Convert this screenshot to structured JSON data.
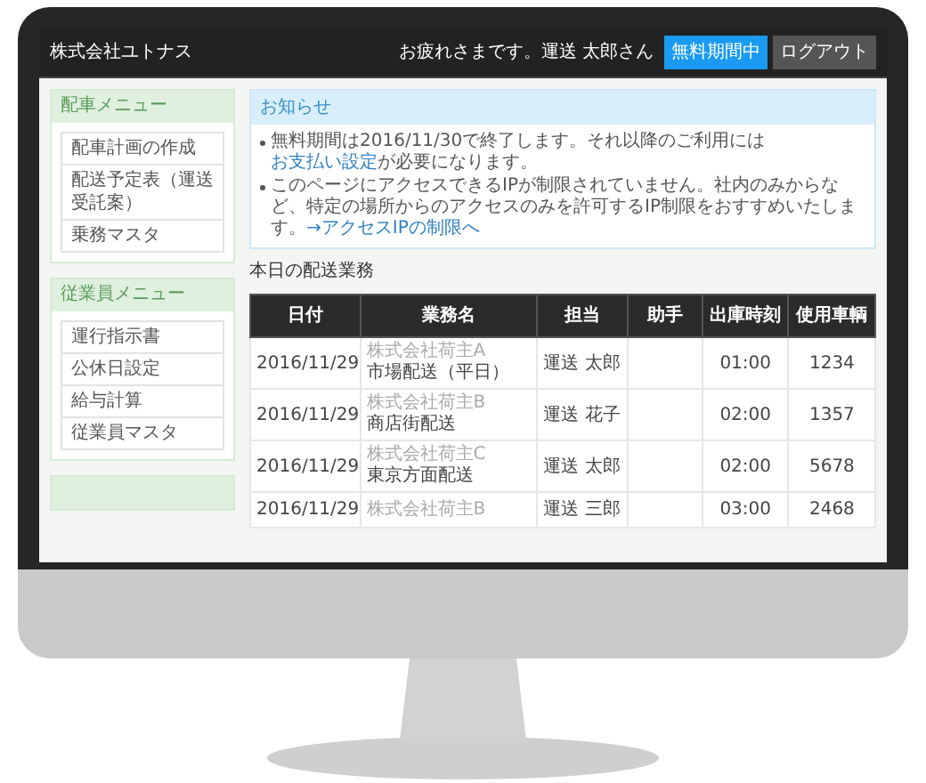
{
  "header": {
    "brand": "株式会社ユトナス",
    "greeting": "お疲れさまです。運送 太郎さん",
    "buttons": [
      {
        "kind": "primary",
        "label": "無料期間中"
      },
      {
        "kind": "secondary",
        "label": "ログアウト"
      }
    ]
  },
  "sidebar": [
    {
      "title": "配車メニュー",
      "items": [
        "配車計画の作成",
        "配送予定表（運送受託案）",
        "乗務マスタ"
      ]
    },
    {
      "title": "従業員メニュー",
      "items": [
        "運行指示書",
        "公休日設定",
        "給与計算",
        "従業員マスタ"
      ]
    }
  ],
  "notice": {
    "title": "お知らせ",
    "items": [
      "無料期間は2016/11/30で終了します。それ以降のご利用には**お支払い設定**が必要になります。",
      "このページにアクセスできるIPが制限されていません。社内のみからなど、特定の場所からのアクセスのみを許可するIP制限をおすすめいたします。**→アクセスIPの制限へ**"
    ]
  },
  "table": {
    "title": "本日の配送業務",
    "columns": [
      "日付",
      "業務名",
      "担当",
      "助手",
      "出庫時刻",
      "使用車輌"
    ],
    "rows": [
      {
        "date": "2016/11/29",
        "client": "株式会社荷主A",
        "task": "市場配送（平日）",
        "driver": "運送 太郎",
        "time": "01:00",
        "vehicle": "1234"
      },
      {
        "date": "2016/11/29",
        "client": "株式会社荷主B",
        "task": "商店街配送",
        "driver": "運送 花子",
        "time": "02:00",
        "vehicle": "1357"
      },
      {
        "date": "2016/11/29",
        "client": "株式会社荷主C",
        "task": "東京方面配送",
        "driver": "運送 太郎",
        "time": "02:00",
        "vehicle": "5678"
      },
      {
        "date": "2016/11/29",
        "client": "株式会社荷主B",
        "driver": "運送 三郎",
        "time": "03:00",
        "vehicle": "2468"
      }
    ]
  }
}
